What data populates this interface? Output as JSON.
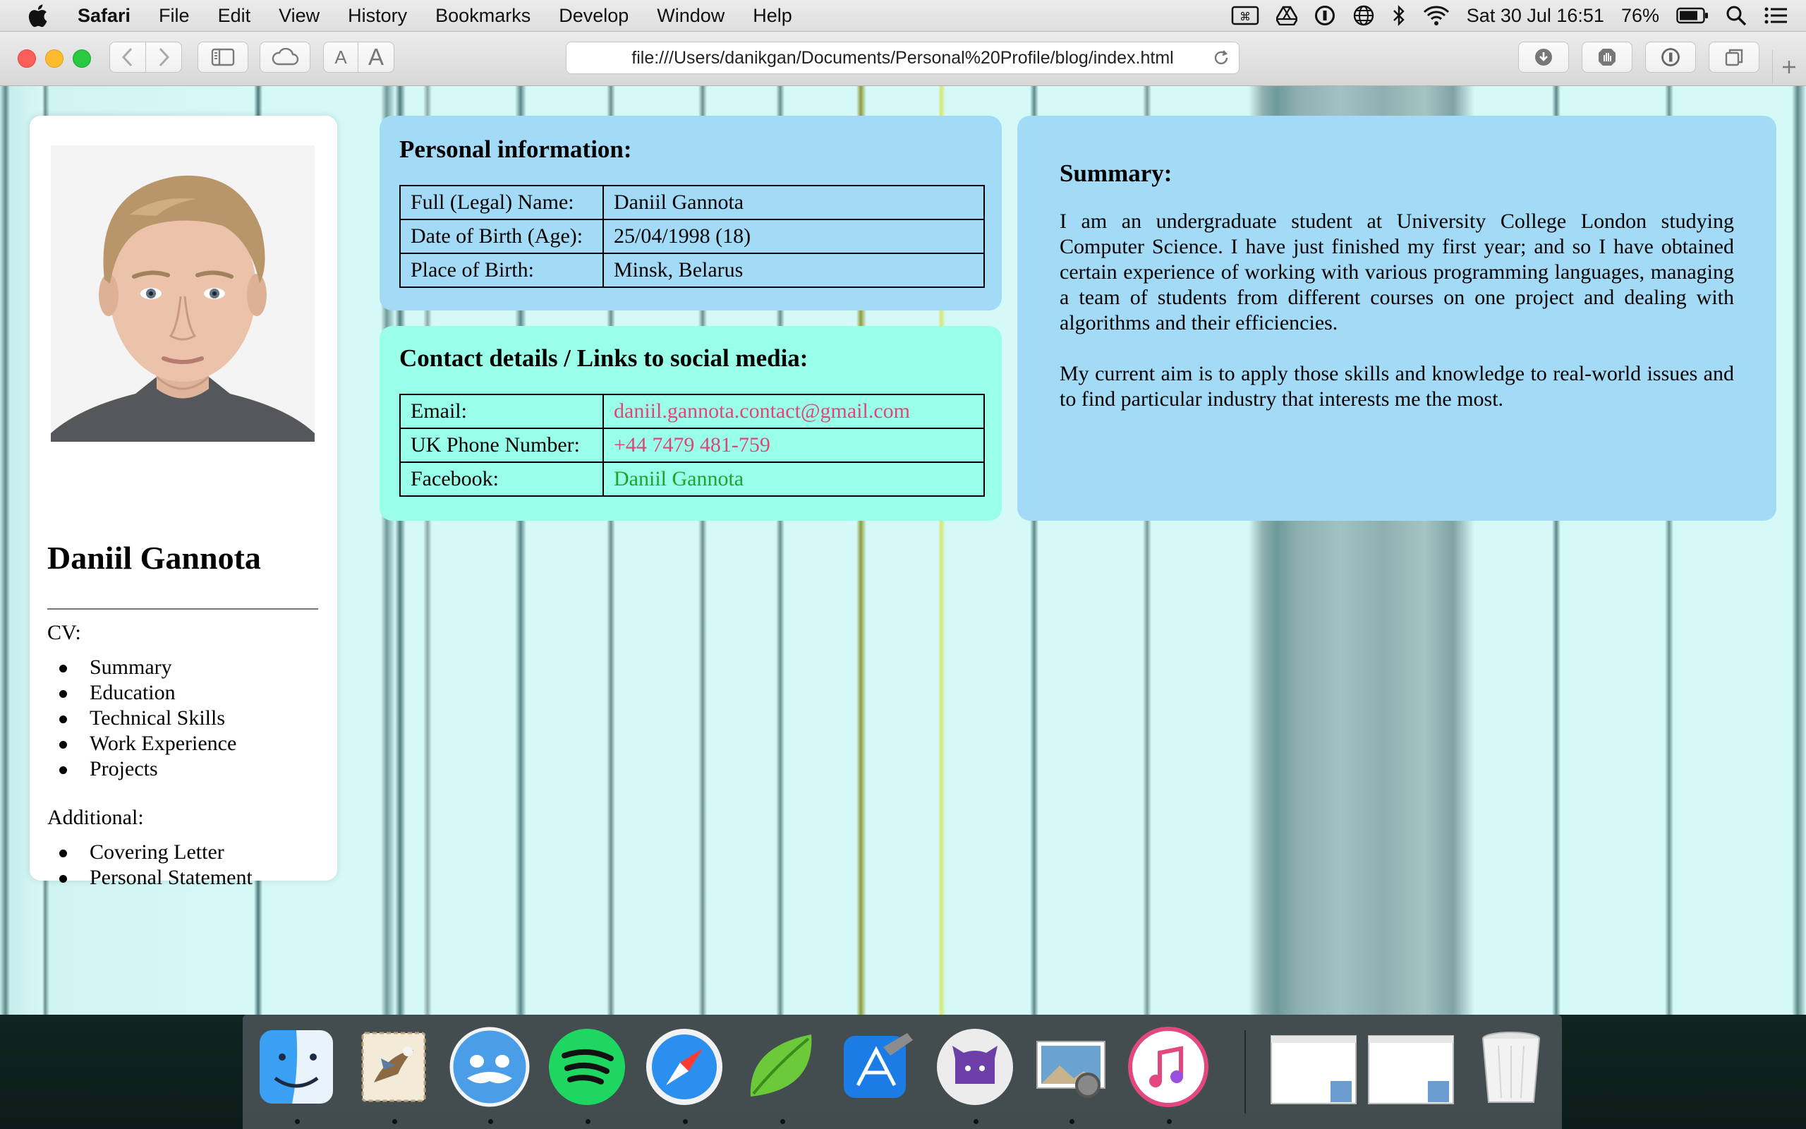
{
  "menubar": {
    "app_name": "Safari",
    "menus": [
      "File",
      "Edit",
      "View",
      "History",
      "Bookmarks",
      "Develop",
      "Window",
      "Help"
    ],
    "status": {
      "datetime": "Sat 30 Jul  16:51",
      "battery": "76%",
      "icons": [
        "command-key-icon",
        "google-drive-icon",
        "1password-icon",
        "globe-icon",
        "bluetooth-icon",
        "wifi-icon",
        "battery-icon",
        "spotlight-search-icon",
        "notification-center-icon"
      ]
    }
  },
  "browser": {
    "url": "file:///Users/danikgan/Documents/Personal%20Profile/blog/index.html",
    "font_small_label": "A",
    "font_large_label": "A"
  },
  "profile": {
    "name": "Daniil Gannota",
    "cv_label": "CV:",
    "cv_items": [
      "Summary",
      "Education",
      "Technical Skills",
      "Work Experience",
      "Projects"
    ],
    "additional_label": "Additional:",
    "additional_items": [
      "Covering Letter",
      "Personal Statement"
    ]
  },
  "personal_info": {
    "title": "Personal information:",
    "rows": [
      {
        "key": "Full (Legal) Name:",
        "value": "Daniil Gannota"
      },
      {
        "key": "Date of Birth (Age):",
        "value": "25/04/1998 (18)"
      },
      {
        "key": "Place of Birth:",
        "value": "Minsk, Belarus"
      }
    ]
  },
  "contact": {
    "title": "Contact details / Links to social media:",
    "rows": [
      {
        "key": "Email:",
        "value": "daniil.gannota.contact@gmail.com"
      },
      {
        "key": "UK Phone Number:",
        "value": "+44 7479 481-759"
      },
      {
        "key": "Facebook:",
        "value": "Daniil Gannota"
      }
    ]
  },
  "summary": {
    "title": "Summary:",
    "paragraphs": [
      "I am an undergraduate student at University College London studying Computer Science. I have just finished my first year; and so I have obtained certain experience of working with various programming languages, managing a team of students from different courses on one project and dealing with algorithms and their efficiencies.",
      "My current aim is to apply those skills and knowledge to real-world issues and to find particular industry that interests me the most."
    ]
  },
  "dock": {
    "apps": [
      "finder-icon",
      "mail-icon",
      "tweetbot-icon",
      "spotify-icon",
      "safari-icon",
      "coda-icon",
      "xcode-icon",
      "github-desktop-icon",
      "preview-icon",
      "itunes-icon",
      "document-icon",
      "document-icon",
      "trash-icon"
    ]
  },
  "colors": {
    "info_card": "#a3dbf6",
    "contact_card": "#99ffe8",
    "link_pink": "#e0457a",
    "link_green": "#1ea32f"
  }
}
